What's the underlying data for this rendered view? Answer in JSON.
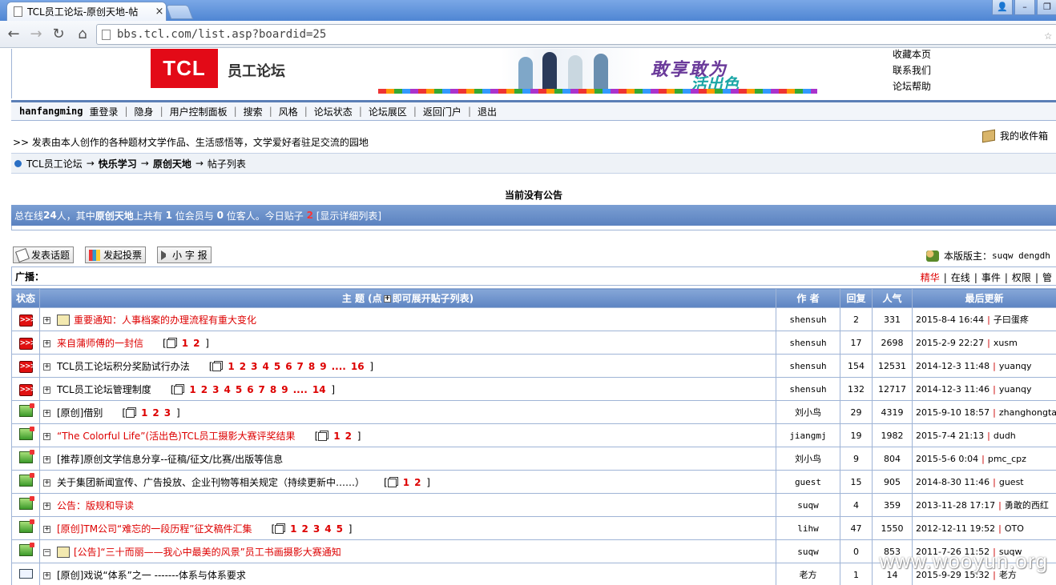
{
  "browser": {
    "tab_title": "TCL员工论坛-原创天地-帖",
    "tab_close": "×",
    "url": "bbs.tcl.com/list.asp?boardid=25",
    "back_icon": "←",
    "forward_icon": "→",
    "reload_icon": "↻",
    "home_icon": "⌂",
    "star_icon": "☆",
    "user_icon": "👤",
    "min_icon": "–",
    "max_icon": "❐"
  },
  "header": {
    "logo_text": "TCL",
    "forum_name": "员工论坛",
    "banner_slogan": "敢享敢为",
    "banner_slogan2": "活出色",
    "links": [
      "收藏本页",
      "联系我们",
      "论坛帮助"
    ]
  },
  "menu": {
    "username": "hanfangming",
    "items": [
      "重登录",
      "隐身",
      "用户控制面板",
      "搜索",
      "风格",
      "论坛状态",
      "论坛展区",
      "返回门户",
      "退出"
    ]
  },
  "board": {
    "description": ">> 发表由本人创作的各种题材文学作品、生活感悟等，文学爱好者驻足交流的园地",
    "mailbox": "我的收件箱"
  },
  "breadcrumb": {
    "root": "TCL员工论坛",
    "arrow": "→",
    "section": "快乐学习",
    "board": "原创天地",
    "page": "帖子列表"
  },
  "notice": "当前没有公告",
  "online": {
    "prefix": "总在线",
    "total": "24",
    "mid1": "人，其中",
    "board": "原创天地",
    "mid2": "上共有 ",
    "members": "1",
    "mid3": " 位会员与 ",
    "guests": "0",
    "mid4": " 位客人。今日贴子 ",
    "today": "2",
    "detail": " [显示详细列表]"
  },
  "actions": {
    "post": "发表话题",
    "vote": "发起投票",
    "note": "小 字 报",
    "moderators_label": "本版版主：",
    "moderators": "suqw dengdh"
  },
  "adbar": {
    "label": "广播：",
    "filters": [
      "精华",
      "在线",
      "事件",
      "权限",
      "管"
    ]
  },
  "table": {
    "headers": {
      "status": "状态",
      "title": "主 题 (点",
      "title_plus": "+",
      "title_suffix": "即可展开贴子列表)",
      "author": "作 者",
      "replies": "回复",
      "views": "人气",
      "last": "最后更新"
    },
    "rows": [
      {
        "status": "hot",
        "icon": true,
        "title": "重要通知：人事档案的办理流程有重大变化",
        "red": true,
        "pages": [],
        "ellipsis": "",
        "last_page": "",
        "author": "shensuh",
        "replies": "2",
        "views": "331",
        "last_time": "2015-8-4 16:44",
        "last_user": "子曰蛋疼"
      },
      {
        "status": "hot",
        "icon": false,
        "title": "来自蒲师傅的一封信",
        "red": true,
        "pages": [
          "1",
          "2"
        ],
        "ellipsis": "",
        "last_page": "",
        "author": "shensuh",
        "replies": "17",
        "views": "2698",
        "last_time": "2015-2-9 22:27",
        "last_user": "xusm"
      },
      {
        "status": "hot",
        "icon": false,
        "title": "TCL员工论坛积分奖励试行办法",
        "red": false,
        "pages": [
          "1",
          "2",
          "3",
          "4",
          "5",
          "6",
          "7",
          "8",
          "9"
        ],
        "ellipsis": "....",
        "last_page": "16",
        "author": "shensuh",
        "replies": "154",
        "views": "12531",
        "last_time": "2014-12-3 11:48",
        "last_user": "yuanqy"
      },
      {
        "status": "hot",
        "icon": false,
        "title": "TCL员工论坛管理制度",
        "red": false,
        "pages": [
          "1",
          "2",
          "3",
          "4",
          "5",
          "6",
          "7",
          "8",
          "9"
        ],
        "ellipsis": "....",
        "last_page": "14",
        "author": "shensuh",
        "replies": "132",
        "views": "12717",
        "last_time": "2014-12-3 11:46",
        "last_user": "yuanqy"
      },
      {
        "status": "folder",
        "icon": false,
        "title": "[原创]借别",
        "red": false,
        "pages": [
          "1",
          "2",
          "3"
        ],
        "ellipsis": "",
        "last_page": "",
        "author": "刘小鸟",
        "replies": "29",
        "views": "4319",
        "last_time": "2015-9-10 18:57",
        "last_user": "zhanghongta"
      },
      {
        "status": "folder",
        "icon": false,
        "title": "“The Colorful Life”(活出色)TCL员工摄影大赛评奖结果",
        "red": true,
        "pages": [
          "1",
          "2"
        ],
        "ellipsis": "",
        "last_page": "",
        "author": "jiangmj",
        "replies": "19",
        "views": "1982",
        "last_time": "2015-7-4 21:13",
        "last_user": "dudh"
      },
      {
        "status": "folder",
        "icon": false,
        "title": "[推荐]原创文学信息分享--征稿/征文/比赛/出版等信息",
        "red": false,
        "pages": [],
        "ellipsis": "",
        "last_page": "",
        "author": "刘小鸟",
        "replies": "9",
        "views": "804",
        "last_time": "2015-5-6 0:04",
        "last_user": "pmc_cpz"
      },
      {
        "status": "folder",
        "icon": false,
        "title": "关于集团新闻宣传、广告投放、企业刊物等相关规定（持续更新中……）",
        "red": false,
        "pages": [
          "1",
          "2"
        ],
        "ellipsis": "",
        "last_page": "",
        "author": "guest",
        "replies": "15",
        "views": "905",
        "last_time": "2014-8-30 11:46",
        "last_user": "guest"
      },
      {
        "status": "folder",
        "icon": false,
        "title": "公告：版规和导读",
        "red": true,
        "pages": [],
        "ellipsis": "",
        "last_page": "",
        "author": "suqw",
        "replies": "4",
        "views": "359",
        "last_time": "2013-11-28 17:17",
        "last_user": "勇敢的西红"
      },
      {
        "status": "folder",
        "icon": false,
        "title": "[原创]TM公司“难忘的一段历程”征文稿件汇集",
        "red": true,
        "pages": [
          "1",
          "2",
          "3",
          "4",
          "5"
        ],
        "ellipsis": "",
        "last_page": "",
        "author": "lihw",
        "replies": "47",
        "views": "1550",
        "last_time": "2012-12-11 19:52",
        "last_user": "OTO"
      },
      {
        "status": "folder",
        "icon": true,
        "title": "[公告]“三十而丽——我心中最美的风景”员工书画摄影大赛通知",
        "red": true,
        "pages": [],
        "ellipsis": "",
        "last_page": "",
        "author": "suqw",
        "replies": "0",
        "views": "853",
        "last_time": "2011-7-26 11:52",
        "last_user": "suqw"
      },
      {
        "status": "mail",
        "icon": false,
        "title": "[原创]戏说“体系”之一 -------体系与体系要求",
        "red": false,
        "pages": [],
        "ellipsis": "",
        "last_page": "",
        "author": "老方",
        "replies": "1",
        "views": "14",
        "last_time": "2015-9-29 15:32",
        "last_user": "老方"
      }
    ]
  },
  "watermark": "www.wooyun.org"
}
